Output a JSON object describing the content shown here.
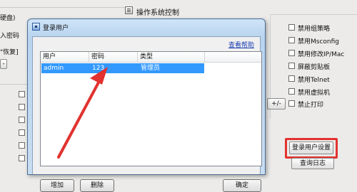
{
  "left_panel": {
    "text1": "硬盘)",
    "text2": "入密码",
    "text3": "\"恢复]",
    "dash": "-"
  },
  "top": {
    "section_title": "操作系统控制"
  },
  "right_options": [
    {
      "label": "禁用组策略"
    },
    {
      "label": "禁用Msconfig"
    },
    {
      "label": "禁用修改IP/Mac"
    },
    {
      "label": "屏蔽剪贴板"
    },
    {
      "label": "禁用Telnet"
    },
    {
      "label": "禁用虚拟机"
    },
    {
      "label": "禁止打印"
    }
  ],
  "plus_minus": "+/-",
  "login_settings_button": "登录用户设置",
  "query_log_button": "查询日志",
  "dialog": {
    "title": "登录用户",
    "help_link": "查看帮助",
    "columns": [
      "用户",
      "密码",
      "类型"
    ],
    "rows": [
      {
        "user": "admin",
        "password": "123",
        "type": "管理员"
      }
    ],
    "add_button": "增加",
    "delete_button": "删除",
    "ok_button": "确定"
  },
  "colors": {
    "annotation": "#e2322f",
    "selection": "#3399ff",
    "link": "#1a3fb0"
  }
}
